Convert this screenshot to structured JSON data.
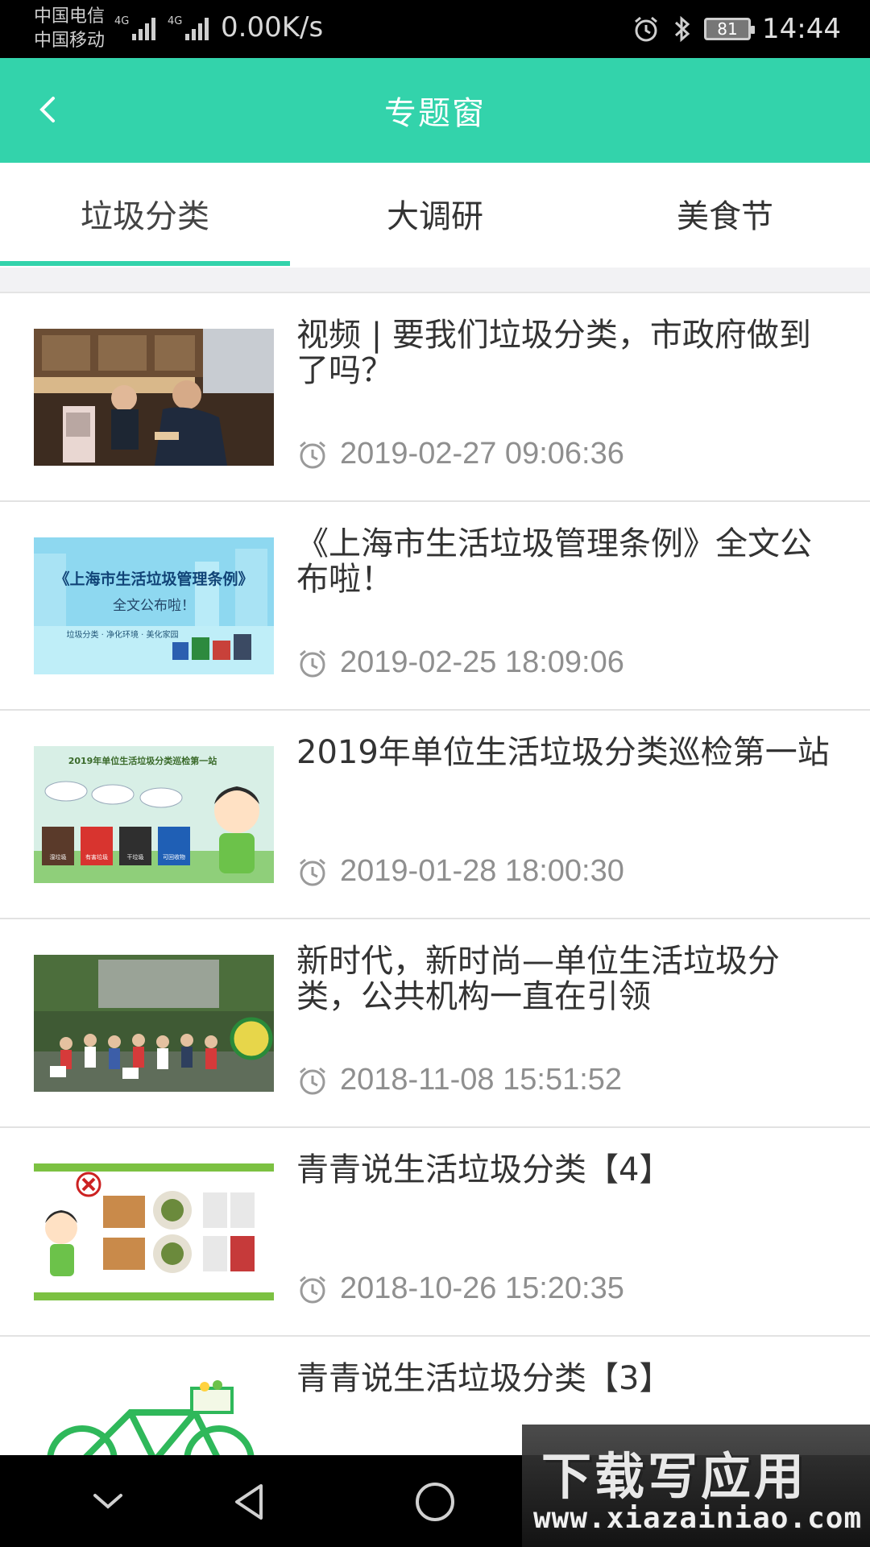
{
  "status_bar": {
    "carrier_1": "中国电信",
    "carrier_2": "中国移动",
    "network_1": "4G",
    "network_2": "4G",
    "net_speed": "0.00K/s",
    "battery": "81",
    "time": "14:44",
    "icons": [
      "alarm-icon",
      "bluetooth-icon",
      "battery-icon"
    ]
  },
  "app_bar": {
    "title": "专题窗",
    "back_icon": "chevron-left-icon"
  },
  "tabs": [
    {
      "label": "垃圾分类",
      "active": true
    },
    {
      "label": "大调研",
      "active": false
    },
    {
      "label": "美食节",
      "active": false
    }
  ],
  "colors": {
    "accent": "#33d3ab",
    "title_text": "#333333",
    "time_text": "#8f8f8f"
  },
  "articles": [
    {
      "title": "视频 | 要我们垃圾分类，市政府做到了吗？",
      "time": "2019-02-27 09:06:36",
      "thumbnail": "photo-office-counter"
    },
    {
      "title": "《上海市生活垃圾管理条例》全文公布啦！",
      "time": "2019-02-25 18:09:06",
      "thumbnail": "poster-regulation",
      "thumb_text": {
        "headline": "《上海市生活垃圾管理条例》",
        "sub": "全文公布啦！",
        "tagline": "垃圾分类 · 净化环境 · 美化家园"
      }
    },
    {
      "title": "2019年单位生活垃圾分类巡检第一站",
      "time": "2019-01-28 18:00:30",
      "thumbnail": "illustration-bins",
      "thumb_text": {
        "headline": "2019年单位生活垃圾分类巡检第一站",
        "bins": [
          "湿垃圾",
          "有害垃圾",
          "干垃圾",
          "可回收物"
        ]
      }
    },
    {
      "title": "新时代，新时尚—单位生活垃圾分类，公共机构一直在引领",
      "time": "2018-11-08 15:51:52",
      "thumbnail": "photo-group"
    },
    {
      "title": "青青说生活垃圾分类【4】",
      "time": "2018-10-26 15:20:35",
      "thumbnail": "illustration-food-trays"
    },
    {
      "title": "青青说生活垃圾分类【3】",
      "time": "",
      "thumbnail": "illustration-bicycle"
    }
  ],
  "nav_bar": {
    "icons": [
      "chevron-down-icon",
      "back-triangle-icon",
      "home-circle-icon"
    ]
  },
  "watermark": {
    "logo": "下载写应用",
    "url": "www.xiazainiao.com"
  }
}
